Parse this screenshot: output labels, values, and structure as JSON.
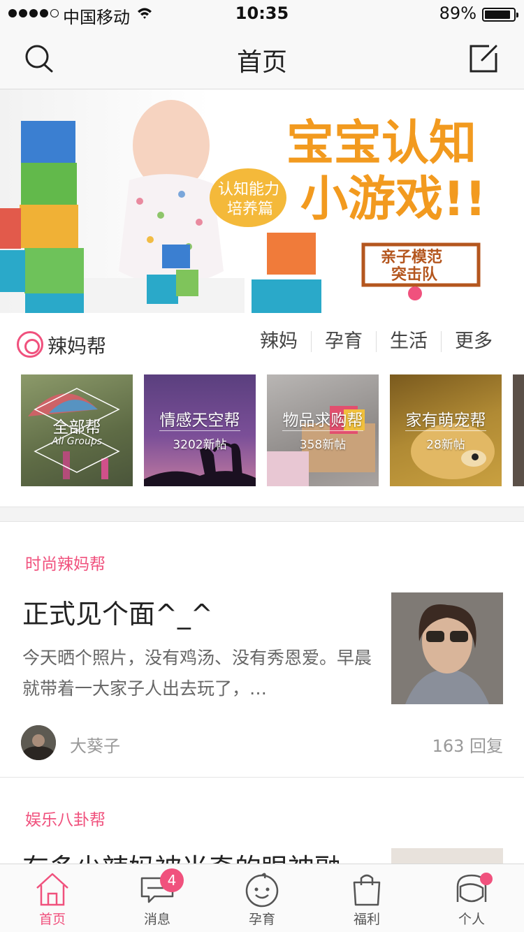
{
  "status": {
    "carrier": "中国移动",
    "time": "10:35",
    "battery": "89%"
  },
  "nav": {
    "title": "首页"
  },
  "group": {
    "title": "辣妈帮",
    "tabs": [
      "辣妈",
      "孕育",
      "生活",
      "更多"
    ],
    "cards": [
      {
        "title": "全部帮",
        "sub": "All Groups"
      },
      {
        "title": "情感天空帮",
        "count": "3202新帖"
      },
      {
        "title": "物品求购帮",
        "count": "358新帖"
      },
      {
        "title": "家有萌宠帮",
        "count": "28新帖"
      }
    ]
  },
  "posts": [
    {
      "tag": "时尚辣妈帮",
      "title": "正式见个面^_^",
      "snippet": "今天晒个照片，没有鸡汤、没有秀恩爱。早晨就带着一大家子人出去玩了，…",
      "author": "大葵子",
      "replies": "163 回复"
    },
    {
      "tag": "娱乐八卦帮",
      "title": "有多少辣妈被当奇的眼神融"
    }
  ],
  "tabbar": [
    {
      "label": "首页",
      "icon": "home-icon",
      "active": true
    },
    {
      "label": "消息",
      "icon": "message-icon",
      "badge": "4"
    },
    {
      "label": "孕育",
      "icon": "baby-face-icon"
    },
    {
      "label": "福利",
      "icon": "shopping-bag-icon"
    },
    {
      "label": "个人",
      "icon": "profile-icon",
      "dot": true
    }
  ],
  "colors": {
    "accent": "#f0517d",
    "background": "#ffffff",
    "bar": "#f8f8f8"
  }
}
